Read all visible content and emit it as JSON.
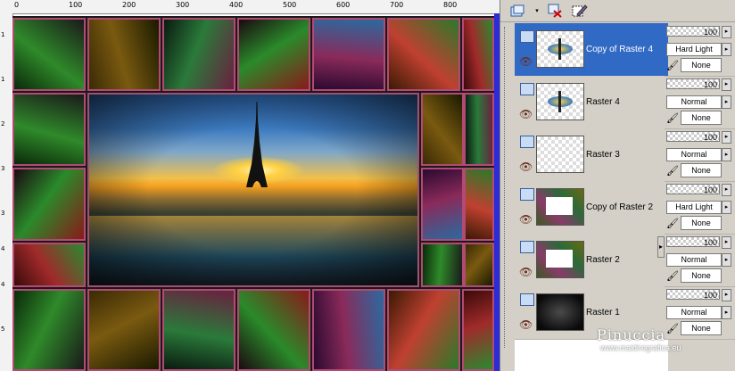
{
  "ruler": {
    "top_marks": [
      "0",
      "100",
      "200",
      "300",
      "400",
      "500",
      "600",
      "700",
      "800"
    ],
    "left_marks": [
      "1",
      "1",
      "2",
      "3",
      "3",
      "4",
      "4",
      "5"
    ]
  },
  "toolbar": {
    "icons": [
      "new-layer-icon",
      "delete-layer-icon",
      "edit-icon"
    ]
  },
  "layers": [
    {
      "name": "Copy of Raster 4",
      "selected": true,
      "thumb": "tower"
    },
    {
      "name": "Raster 4",
      "selected": false,
      "thumb": "tower"
    },
    {
      "name": "Raster 3",
      "selected": false,
      "thumb": "empty"
    },
    {
      "name": "Copy of Raster 2",
      "selected": false,
      "thumb": "frame"
    },
    {
      "name": "Raster 2",
      "selected": false,
      "thumb": "frame"
    },
    {
      "name": "Raster 1",
      "selected": false,
      "thumb": "dark"
    }
  ],
  "properties": [
    {
      "opacity": "100",
      "blend": "Hard Light",
      "mask": "None"
    },
    {
      "opacity": "100",
      "blend": "Normal",
      "mask": "None"
    },
    {
      "opacity": "100",
      "blend": "Normal",
      "mask": "None"
    },
    {
      "opacity": "100",
      "blend": "Hard Light",
      "mask": "None"
    },
    {
      "opacity": "100",
      "blend": "Normal",
      "mask": "None"
    },
    {
      "opacity": "100",
      "blend": "Normal",
      "mask": "None"
    }
  ],
  "watermark": {
    "title": "Pinuccia",
    "url": "www.maidiregrafica.eu"
  },
  "colors": {
    "selection": "#316ac5",
    "tile_border": "#b24a73",
    "scrollbar": "#2b2bd8"
  }
}
